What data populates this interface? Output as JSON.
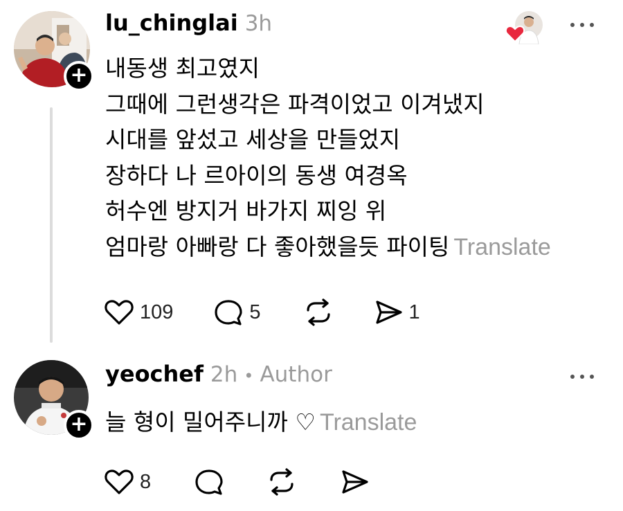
{
  "posts": [
    {
      "username": "lu_chinglai",
      "time": "3h",
      "lines": [
        "내동생 최고였지",
        "그때에 그런생각은 파격이었고 이겨냈지",
        "시대를 앞섰고 세상을 만들었지",
        "장하다 나 르아이의 동생 여경옥",
        "허수엔 방지거 바가지 찌잉 위",
        "엄마랑 아빠랑 다 좋아했을듯 파이팅"
      ],
      "translate_label": "Translate",
      "likes": "109",
      "comments": "5",
      "shares": "1"
    },
    {
      "username": "yeochef",
      "time": "2h",
      "separator": "•",
      "author_badge": "Author",
      "lines": [
        "늘 형이 밀어주니까 ♡"
      ],
      "translate_label": "Translate",
      "likes": "8"
    }
  ],
  "icons": {
    "like": "heart-outline-icon",
    "comment": "speech-bubble-icon",
    "repost": "repost-icon",
    "share": "send-icon",
    "more": "more-options-icon",
    "follow": "plus-icon",
    "liked_by_author": "red-heart-icon"
  },
  "colors": {
    "secondary_text": "#9a9a9a",
    "liked_heart": "#e8283e"
  }
}
